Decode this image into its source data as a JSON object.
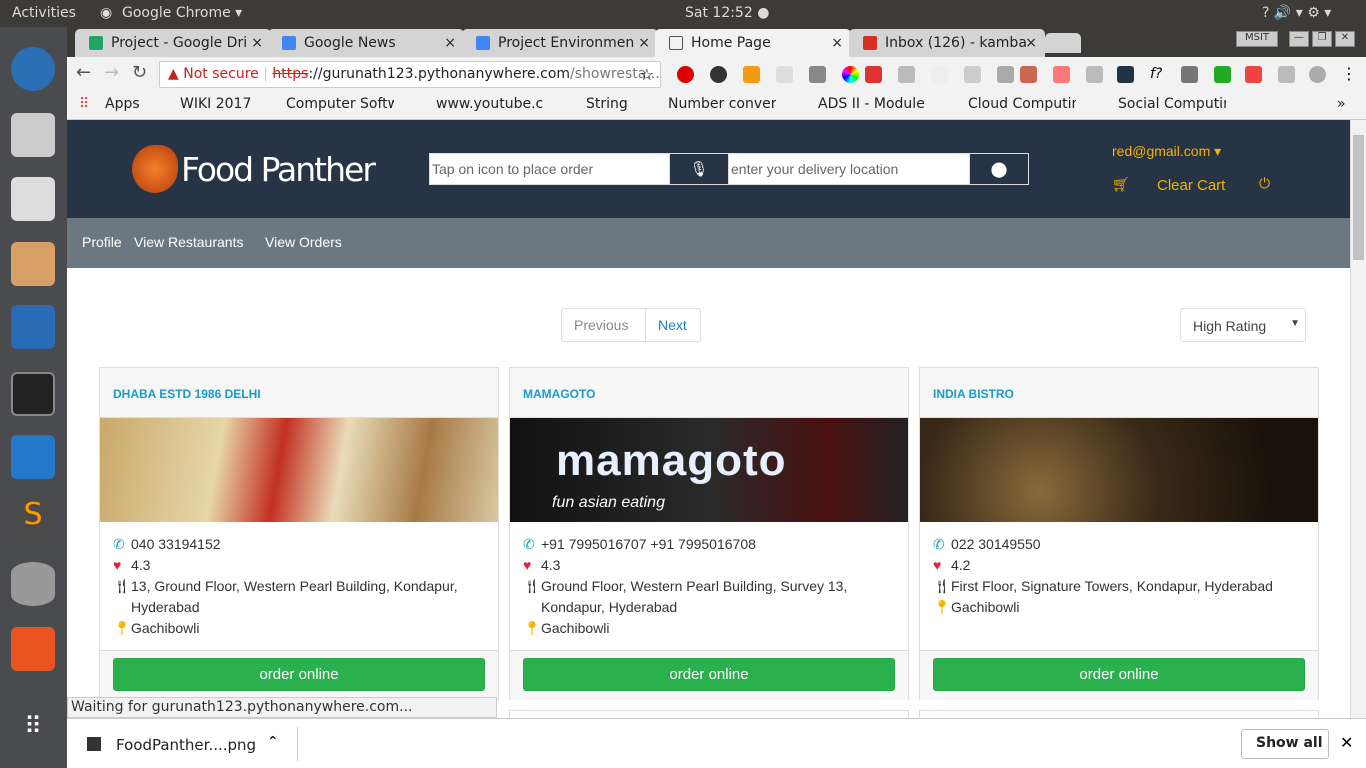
{
  "os": {
    "activities": "Activities",
    "app_menu": "Google Chrome ▾",
    "clock": "Sat 12:52 ●",
    "tray": "?  🔊  ▾  ⚙ ▾"
  },
  "browser": {
    "tabs": [
      {
        "label": "Project - Google Dri",
        "color": "#1fa463"
      },
      {
        "label": "Google News",
        "color": "#4285f4"
      },
      {
        "label": "Project Environmen",
        "color": "#4285f4"
      },
      {
        "label": "Home Page",
        "color": "#ffffff"
      },
      {
        "label": "Inbox (126) - kamba",
        "color": "#d93025"
      }
    ],
    "profile": "MSIT",
    "not_secure": "Not secure",
    "url_scheme": "https",
    "url_host": "://gurunath123.pythonanywhere.com",
    "url_path": "/showresta...",
    "bookmarks": [
      "Apps",
      "WIKI 2017",
      "Computer Softw",
      "www.youtube.c",
      "String",
      "Number convert",
      "ADS II - Module",
      "Cloud Computin",
      "Social Computin"
    ],
    "status": "Waiting for gurunath123.pythonanywhere.com...",
    "download": "FoodPanther....png",
    "show_all": "Show all"
  },
  "site": {
    "brand": "Food Panther",
    "order_placeholder": "Tap on icon to place order",
    "location_placeholder": "enter your delivery location",
    "user": "red@gmail.com",
    "clear_cart": "Clear Cart",
    "nav": [
      "Profile",
      "View Restaurants",
      "View Orders"
    ],
    "previous": "Previous",
    "next": "Next",
    "sort": "High Rating",
    "order_label": "order online",
    "restaurants": [
      {
        "name": "DHABA ESTD 1986 DELHI",
        "phone": "040 33194152",
        "rating": "4.3",
        "address": "13, Ground Floor, Western Pearl Building, Kondapur, Hyderabad",
        "area": "Gachibowli"
      },
      {
        "name": "MAMAGOTO",
        "phone": "+91 7995016707 +91 7995016708",
        "rating": "4.3",
        "address": "Ground Floor, Western Pearl Building, Survey 13, Kondapur, Hyderabad",
        "area": "Gachibowli",
        "image_text": "mamagoto",
        "image_sub": "fun asian eating"
      },
      {
        "name": "INDIA BISTRO",
        "phone": "022 30149550",
        "rating": "4.2",
        "address": "First Floor, Signature Towers, Kondapur, Hyderabad",
        "area": "Gachibowli"
      }
    ]
  }
}
